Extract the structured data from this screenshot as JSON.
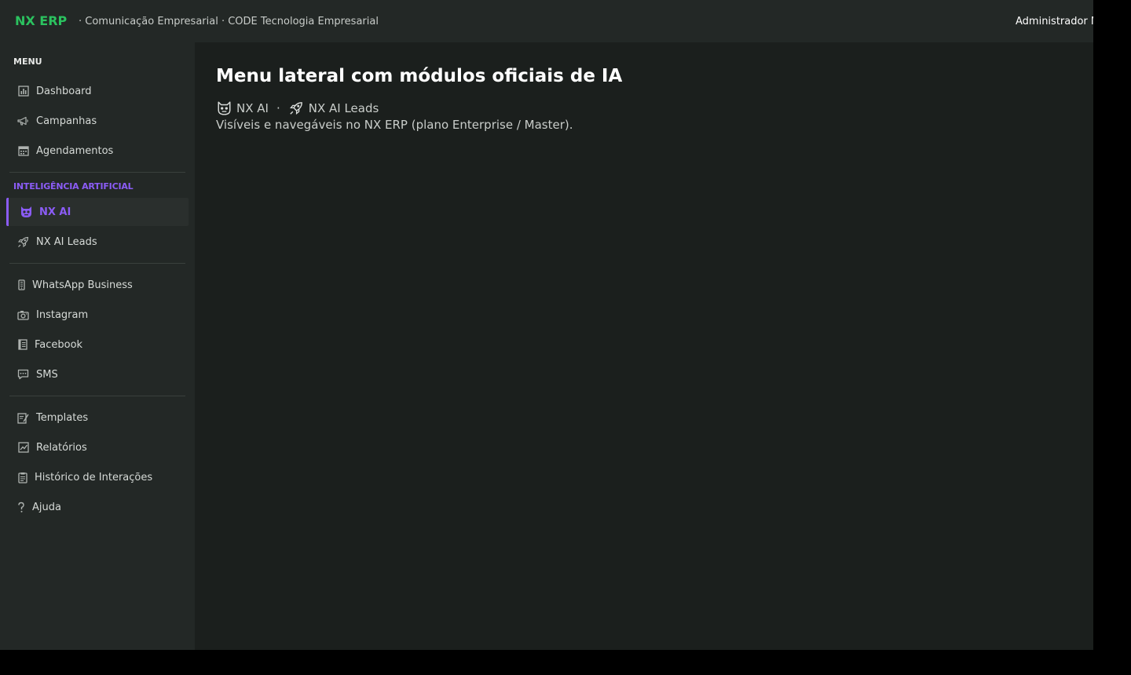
{
  "topbar": {
    "brand": "NX ERP",
    "subtitle": "· Comunicação Empresarial · CODE Tecnologia Empresarial",
    "user": "Administrador M"
  },
  "sidebar": {
    "menu_title": "MENU",
    "ai_title": "INTELIGÊNCIA ARTIFICIAL",
    "items": [
      {
        "label": "Dashboard",
        "icon": "chart-icon"
      },
      {
        "label": "Campanhas",
        "icon": "megaphone-icon"
      },
      {
        "label": "Agendamentos",
        "icon": "calendar-icon"
      },
      {
        "label": "NX AI",
        "icon": "robot-icon",
        "active": true
      },
      {
        "label": "NX AI Leads",
        "icon": "rocket-icon"
      },
      {
        "label": "WhatsApp Business",
        "icon": "phone-icon"
      },
      {
        "label": "Instagram",
        "icon": "camera-icon"
      },
      {
        "label": "Facebook",
        "icon": "book-icon"
      },
      {
        "label": "SMS",
        "icon": "chat-icon"
      },
      {
        "label": "Templates",
        "icon": "edit-icon"
      },
      {
        "label": "Relatórios",
        "icon": "report-icon"
      },
      {
        "label": "Histórico de Interações",
        "icon": "clipboard-icon"
      },
      {
        "label": "Ajuda",
        "icon": "help-icon"
      }
    ]
  },
  "main": {
    "title": "Menu lateral com módulos oficiais de IA",
    "tag1": "NX AI",
    "separator": "·",
    "tag2": "NX AI Leads",
    "description": "Visíveis e navegáveis no NX ERP (plano Enterprise / Master)."
  },
  "colors": {
    "accent_green": "#2bc25f",
    "accent_purple": "#8b5cf6",
    "sidebar_bg": "#232826",
    "main_bg": "#1b1f1d"
  }
}
